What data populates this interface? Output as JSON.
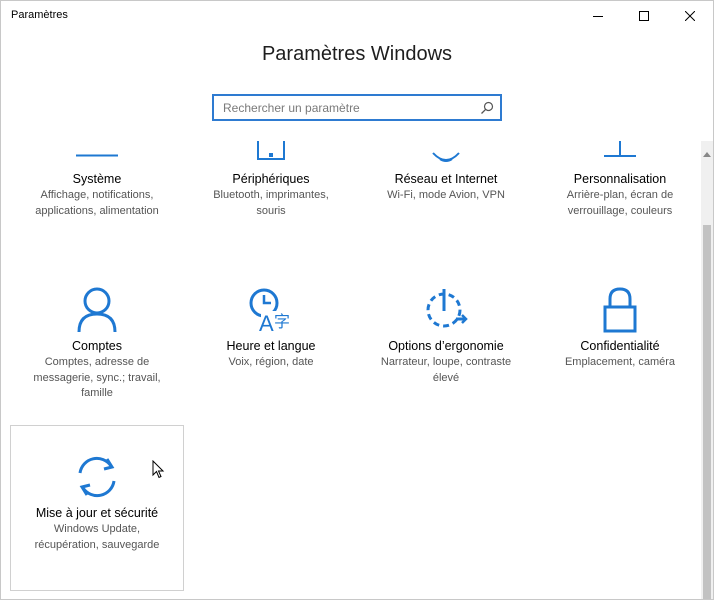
{
  "window": {
    "title": "Paramètres",
    "controls": [
      "minimize-icon",
      "maximize-icon",
      "close-icon"
    ]
  },
  "header": {
    "title": "Paramètres Windows"
  },
  "search": {
    "placeholder": "Rechercher un paramètre",
    "icon": "search-icon"
  },
  "accent_color": "#1e78d2",
  "tiles": [
    {
      "name": "Système",
      "desc1": "Affichage, notifications,",
      "desc2": "applications, alimentation",
      "desc3": "",
      "icon": "display-icon"
    },
    {
      "name": "Périphériques",
      "desc1": "Bluetooth, imprimantes,",
      "desc2": "souris",
      "desc3": "",
      "icon": "devices-icon"
    },
    {
      "name": "Réseau et Internet",
      "desc1": "Wi-Fi, mode Avion, VPN",
      "desc2": "",
      "desc3": "",
      "icon": "globe-icon"
    },
    {
      "name": "Personnalisation",
      "desc1": "Arrière-plan, écran de",
      "desc2": "verrouillage, couleurs",
      "desc3": "",
      "icon": "paint-icon"
    },
    {
      "name": "Comptes",
      "desc1": "Comptes, adresse de",
      "desc2": "messagerie, sync.; travail,",
      "desc3": "famille",
      "icon": "person-icon"
    },
    {
      "name": "Heure et langue",
      "desc1": "Voix, région, date",
      "desc2": "",
      "desc3": "",
      "icon": "time-language-icon"
    },
    {
      "name": "Options d’ergonomie",
      "desc1": "Narrateur, loupe, contraste",
      "desc2": "élevé",
      "desc3": "",
      "icon": "ease-of-access-icon"
    },
    {
      "name": "Confidentialité",
      "desc1": "Emplacement, caméra",
      "desc2": "",
      "desc3": "",
      "icon": "lock-icon"
    },
    {
      "name": "Mise à jour et sécurité",
      "desc1": "Windows Update,",
      "desc2": "récupération, sauvegarde",
      "desc3": "",
      "icon": "sync-icon"
    }
  ]
}
